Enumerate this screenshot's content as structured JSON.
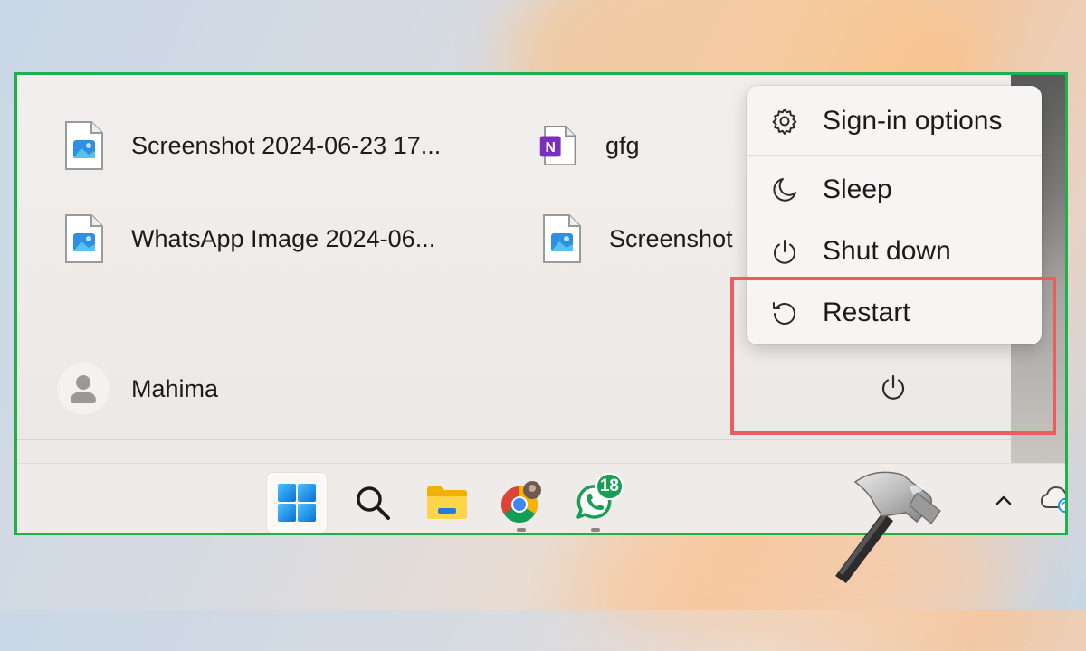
{
  "recent_files": [
    {
      "label": "Screenshot 2024-06-23 17...",
      "icon": "image-file-icon"
    },
    {
      "label": "gfg",
      "icon": "onenote-icon"
    },
    {
      "label": "WhatsApp Image 2024-06...",
      "icon": "image-file-icon"
    },
    {
      "label": "Screenshot",
      "icon": "image-file-icon"
    }
  ],
  "user": {
    "name": "Mahima"
  },
  "power_menu": {
    "items": [
      {
        "label": "Sign-in options",
        "icon": "gear-icon"
      },
      {
        "label": "Sleep",
        "icon": "moon-icon"
      },
      {
        "label": "Shut down",
        "icon": "power-icon"
      },
      {
        "label": "Restart",
        "icon": "restart-icon"
      }
    ]
  },
  "taskbar": {
    "apps": [
      {
        "name": "start",
        "icon": "windows-logo-icon"
      },
      {
        "name": "search",
        "icon": "search-icon"
      },
      {
        "name": "file-explorer",
        "icon": "folder-icon"
      },
      {
        "name": "chrome",
        "icon": "chrome-icon"
      },
      {
        "name": "whatsapp",
        "icon": "whatsapp-icon",
        "badge": "18"
      }
    ]
  },
  "colors": {
    "highlight_green": "#19b24b",
    "highlight_red": "#ec5e5e",
    "windows_blue": "#1e90e6"
  }
}
